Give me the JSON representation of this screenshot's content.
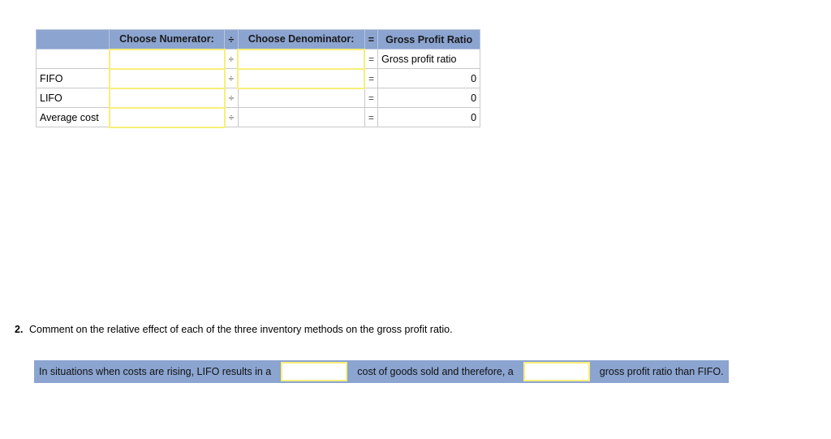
{
  "ratio_table": {
    "headers": {
      "label": "",
      "numerator": "Choose Numerator:",
      "divide_op": "÷",
      "denominator": "Choose Denominator:",
      "equals_op": "=",
      "result": "Gross Profit Ratio"
    },
    "rows": [
      {
        "label": "",
        "numerator_value": "",
        "numerator_fillable": true,
        "divide_op": "÷",
        "denominator_value": "",
        "denominator_fillable": true,
        "equals_op": "=",
        "result": "Gross profit ratio",
        "result_align": "left"
      },
      {
        "label": "FIFO",
        "numerator_value": "",
        "numerator_fillable": true,
        "divide_op": "÷",
        "denominator_value": "",
        "denominator_fillable": true,
        "equals_op": "=",
        "result": "0",
        "result_align": "right"
      },
      {
        "label": "LIFO",
        "numerator_value": "",
        "numerator_fillable": true,
        "divide_op": "÷",
        "denominator_value": "",
        "denominator_fillable": false,
        "equals_op": "=",
        "result": "0",
        "result_align": "right"
      },
      {
        "label": "Average cost",
        "numerator_value": "",
        "numerator_fillable": true,
        "divide_op": "÷",
        "denominator_value": "",
        "denominator_fillable": false,
        "equals_op": "=",
        "result": "0",
        "result_align": "right"
      }
    ]
  },
  "question": {
    "number": "2.",
    "text": "Comment on the relative effect of each of the three inventory methods on the gross profit ratio."
  },
  "answer_bar": {
    "segment_1": "In situations when costs are rising, LIFO results in a",
    "blank_1_value": "",
    "segment_2": "cost of goods sold and therefore, a",
    "blank_2_value": "",
    "segment_3": "gross profit ratio than FIFO."
  },
  "colors": {
    "header_blue": "#8ba4d0",
    "fillable_yellow": "#f7ef7a",
    "grid_gray": "#c9c9c9",
    "page_background": "#ffffff"
  }
}
